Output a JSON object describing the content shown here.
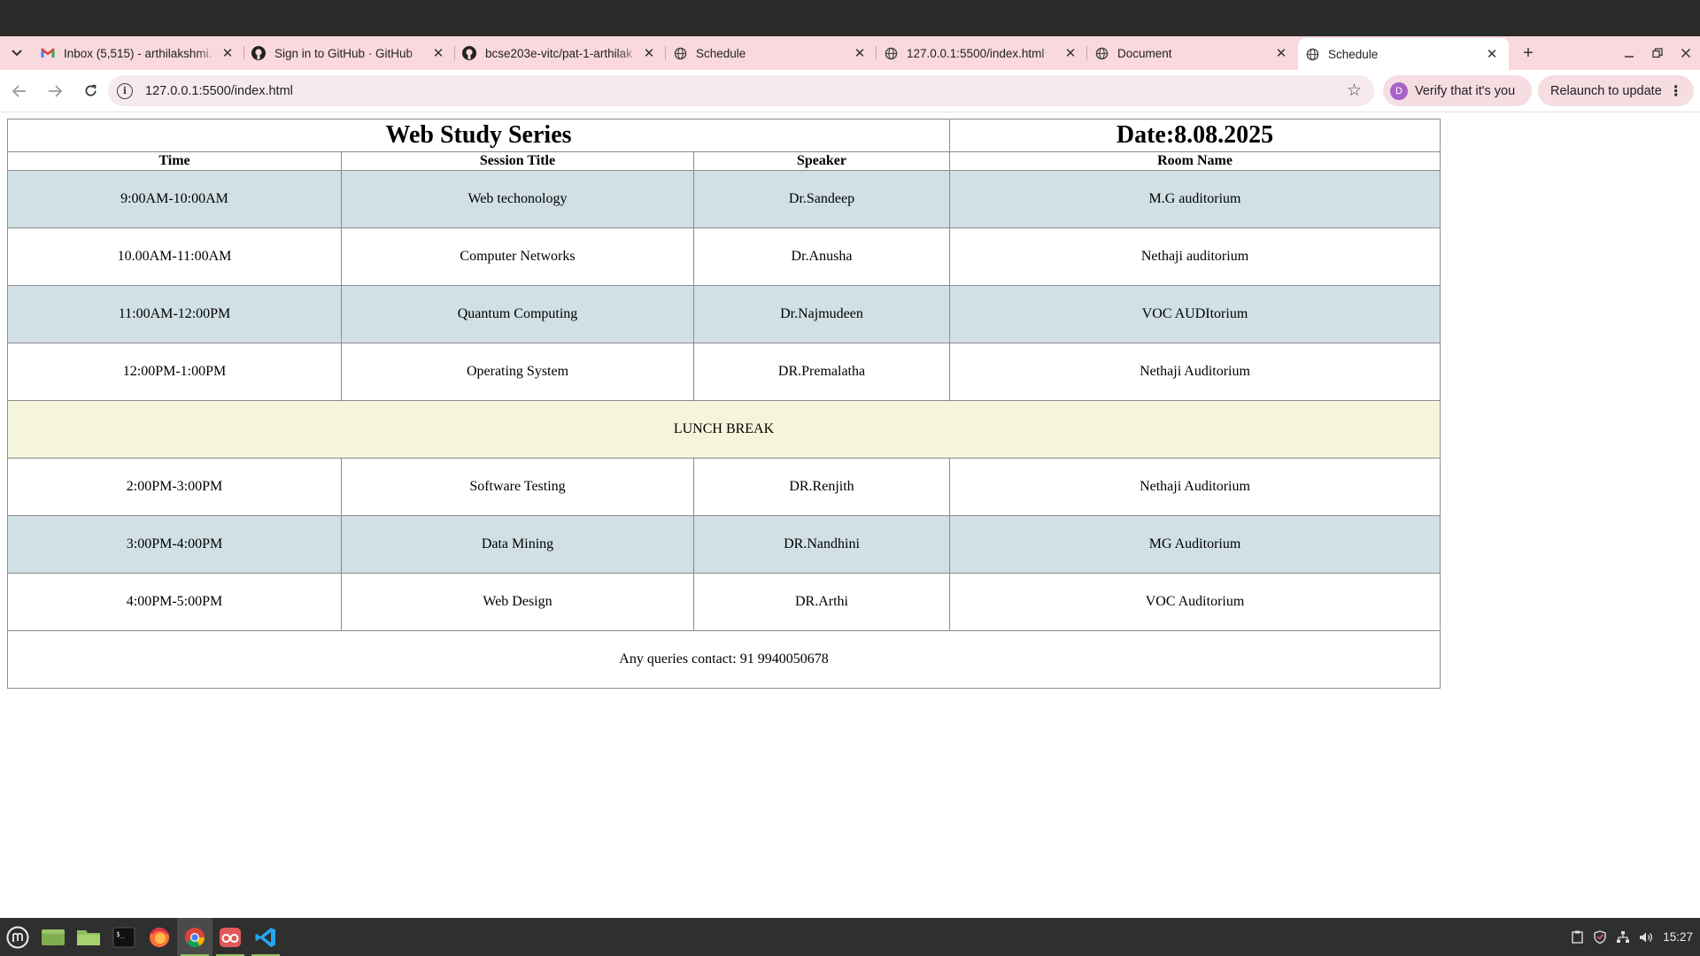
{
  "browser": {
    "tabs": [
      {
        "title": "Inbox (5,515) - arthilakshmi.",
        "icon": "gmail-icon",
        "active": false
      },
      {
        "title": "Sign in to GitHub · GitHub",
        "icon": "github-icon",
        "active": false
      },
      {
        "title": "bcse203e-vitc/pat-1-arthilak",
        "icon": "github-icon",
        "active": false
      },
      {
        "title": "Schedule",
        "icon": "globe-icon",
        "active": false
      },
      {
        "title": "127.0.0.1:5500/index.html",
        "icon": "globe-icon",
        "active": false
      },
      {
        "title": "Document",
        "icon": "globe-icon",
        "active": false
      },
      {
        "title": "Schedule",
        "icon": "globe-icon",
        "active": true
      }
    ],
    "url": "127.0.0.1:5500/index.html",
    "verify_label": "Verify that it's you",
    "profile_initial": "D",
    "relaunch_label": "Relaunch to update"
  },
  "schedule": {
    "title": "Web Study Series",
    "date": "Date:8.08.2025",
    "headers": [
      "Time",
      "Session Title",
      "Speaker",
      "Room Name"
    ],
    "rows_before_lunch": [
      {
        "time": "9:00AM-10:00AM",
        "session": "Web techonology",
        "speaker": "Dr.Sandeep",
        "room": "M.G auditorium"
      },
      {
        "time": "10.00AM-11:00AM",
        "session": "Computer Networks",
        "speaker": "Dr.Anusha",
        "room": "Nethaji auditorium"
      },
      {
        "time": "11:00AM-12:00PM",
        "session": "Quantum Computing",
        "speaker": "Dr.Najmudeen",
        "room": "VOC AUDItorium"
      },
      {
        "time": "12:00PM-1:00PM",
        "session": "Operating System",
        "speaker": "DR.Premalatha",
        "room": "Nethaji Auditorium"
      }
    ],
    "lunch": "LUNCH BREAK",
    "rows_after_lunch": [
      {
        "time": "2:00PM-3:00PM",
        "session": "Software Testing",
        "speaker": "DR.Renjith",
        "room": "Nethaji Auditorium"
      },
      {
        "time": "3:00PM-4:00PM",
        "session": "Data Mining",
        "speaker": "DR.Nandhini",
        "room": "MG Auditorium"
      },
      {
        "time": "4:00PM-5:00PM",
        "session": "Web Design",
        "speaker": "DR.Arthi",
        "room": "VOC Auditorium"
      }
    ],
    "contact": "Any queries contact: 91 9940050678",
    "colors": {
      "shaded_row": "#d1e0e5",
      "lunch_row": "#f5f5dc"
    }
  },
  "taskbar": {
    "apps": [
      "mint-menu-icon",
      "show-desktop-icon",
      "files-icon",
      "terminal-icon",
      "firefox-icon",
      "chrome-icon",
      "webapp-icon",
      "vscode-icon"
    ],
    "clock": "15:27"
  }
}
